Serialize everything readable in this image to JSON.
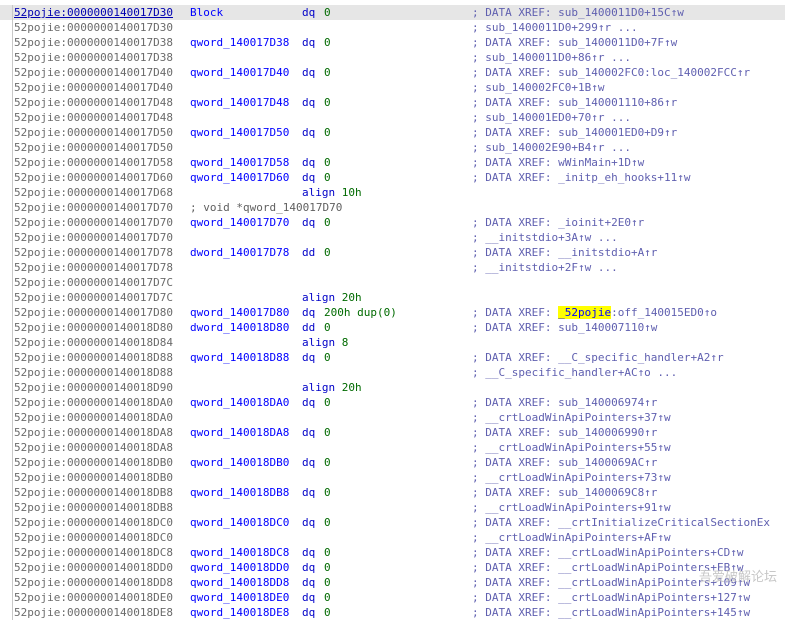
{
  "listing": {
    "rows": [
      {
        "addr": "52pojie:0000000140017D30",
        "name": "Block",
        "mnem": "dq",
        "oper": "0",
        "cmt": "; DATA XREF: sub_1400011D0+15C↑w",
        "sel": true
      },
      {
        "addr": "52pojie:0000000140017D30",
        "cmt": "; sub_1400011D0+299↑r ..."
      },
      {
        "addr": "52pojie:0000000140017D38",
        "name": "qword_140017D38",
        "mnem": "dq",
        "oper": "0",
        "cmt": "; DATA XREF: sub_1400011D0+7F↑w"
      },
      {
        "addr": "52pojie:0000000140017D38",
        "cmt": "; sub_1400011D0+86↑r ..."
      },
      {
        "addr": "52pojie:0000000140017D40",
        "name": "qword_140017D40",
        "mnem": "dq",
        "oper": "0",
        "cmt": "; DATA XREF: sub_140002FC0:loc_140002FCC↑r"
      },
      {
        "addr": "52pojie:0000000140017D40",
        "cmt": "; sub_140002FC0+1B↑w"
      },
      {
        "addr": "52pojie:0000000140017D48",
        "name": "qword_140017D48",
        "mnem": "dq",
        "oper": "0",
        "cmt": "; DATA XREF: sub_140001110+86↑r"
      },
      {
        "addr": "52pojie:0000000140017D48",
        "cmt": "; sub_140001ED0+70↑r ..."
      },
      {
        "addr": "52pojie:0000000140017D50",
        "name": "qword_140017D50",
        "mnem": "dq",
        "oper": "0",
        "cmt": "; DATA XREF: sub_140001ED0+D9↑r"
      },
      {
        "addr": "52pojie:0000000140017D50",
        "cmt": "; sub_140002E90+B4↑r ..."
      },
      {
        "addr": "52pojie:0000000140017D58",
        "name": "qword_140017D58",
        "mnem": "dq",
        "oper": "0",
        "cmt": "; DATA XREF: wWinMain+1D↑w"
      },
      {
        "addr": "52pojie:0000000140017D60",
        "name": "qword_140017D60",
        "mnem": "dq",
        "oper": "0",
        "cmt": "; DATA XREF: _initp_eh_hooks+11↑w"
      },
      {
        "addr": "52pojie:0000000140017D68",
        "align": "align",
        "alignArg": "10h"
      },
      {
        "addr": "52pojie:0000000140017D70",
        "plain": "; void *qword_140017D70"
      },
      {
        "addr": "52pojie:0000000140017D70",
        "name": "qword_140017D70",
        "mnem": "dq",
        "oper": "0",
        "cmt": "; DATA XREF: _ioinit+2E0↑r"
      },
      {
        "addr": "52pojie:0000000140017D70",
        "cmt": "; __initstdio+3A↑w ..."
      },
      {
        "addr": "52pojie:0000000140017D78",
        "name": "dword_140017D78",
        "mnem": "dd",
        "oper": "0",
        "cmt": "; DATA XREF: __initstdio+A↑r"
      },
      {
        "addr": "52pojie:0000000140017D78",
        "cmt": "; __initstdio+2F↑w ..."
      },
      {
        "addr": "52pojie:0000000140017D7C"
      },
      {
        "addr": "52pojie:0000000140017D7C",
        "align": "align",
        "alignArg": "20h"
      },
      {
        "addr": "52pojie:0000000140017D80",
        "name": "qword_140017D80",
        "mnem": "dq",
        "oper": "200h dup(0)",
        "cmtPre": "; DATA XREF: ",
        "cmtHl": "_52pojie",
        "cmtPost": ":off_140015ED0↑o"
      },
      {
        "addr": "52pojie:0000000140018D80",
        "name": "dword_140018D80",
        "mnem": "dd",
        "oper": "0",
        "cmt": "; DATA XREF: sub_140007110↑w"
      },
      {
        "addr": "52pojie:0000000140018D84",
        "align": "align",
        "alignArg": "8"
      },
      {
        "addr": "52pojie:0000000140018D88",
        "name": "qword_140018D88",
        "mnem": "dq",
        "oper": "0",
        "cmt": "; DATA XREF: __C_specific_handler+A2↑r"
      },
      {
        "addr": "52pojie:0000000140018D88",
        "cmt": "; __C_specific_handler+AC↑o ..."
      },
      {
        "addr": "52pojie:0000000140018D90",
        "align": "align",
        "alignArg": "20h"
      },
      {
        "addr": "52pojie:0000000140018DA0",
        "name": "qword_140018DA0",
        "mnem": "dq",
        "oper": "0",
        "cmt": "; DATA XREF: sub_140006974↑r"
      },
      {
        "addr": "52pojie:0000000140018DA0",
        "cmt": "; __crtLoadWinApiPointers+37↑w"
      },
      {
        "addr": "52pojie:0000000140018DA8",
        "name": "qword_140018DA8",
        "mnem": "dq",
        "oper": "0",
        "cmt": "; DATA XREF: sub_140006990↑r"
      },
      {
        "addr": "52pojie:0000000140018DA8",
        "cmt": "; __crtLoadWinApiPointers+55↑w"
      },
      {
        "addr": "52pojie:0000000140018DB0",
        "name": "qword_140018DB0",
        "mnem": "dq",
        "oper": "0",
        "cmt": "; DATA XREF: sub_1400069AC↑r"
      },
      {
        "addr": "52pojie:0000000140018DB0",
        "cmt": "; __crtLoadWinApiPointers+73↑w"
      },
      {
        "addr": "52pojie:0000000140018DB8",
        "name": "qword_140018DB8",
        "mnem": "dq",
        "oper": "0",
        "cmt": "; DATA XREF: sub_1400069C8↑r"
      },
      {
        "addr": "52pojie:0000000140018DB8",
        "cmt": "; __crtLoadWinApiPointers+91↑w"
      },
      {
        "addr": "52pojie:0000000140018DC0",
        "name": "qword_140018DC0",
        "mnem": "dq",
        "oper": "0",
        "cmt": "; DATA XREF: __crtInitializeCriticalSectionEx"
      },
      {
        "addr": "52pojie:0000000140018DC0",
        "cmt": "; __crtLoadWinApiPointers+AF↑w"
      },
      {
        "addr": "52pojie:0000000140018DC8",
        "name": "qword_140018DC8",
        "mnem": "dq",
        "oper": "0",
        "cmt": "; DATA XREF: __crtLoadWinApiPointers+CD↑w"
      },
      {
        "addr": "52pojie:0000000140018DD0",
        "name": "qword_140018DD0",
        "mnem": "dq",
        "oper": "0",
        "cmt": "; DATA XREF: __crtLoadWinApiPointers+EB↑w"
      },
      {
        "addr": "52pojie:0000000140018DD8",
        "name": "qword_140018DD8",
        "mnem": "dq",
        "oper": "0",
        "cmt": "; DATA XREF: __crtLoadWinApiPointers+109↑w"
      },
      {
        "addr": "52pojie:0000000140018DE0",
        "name": "qword_140018DE0",
        "mnem": "dq",
        "oper": "0",
        "cmt": "; DATA XREF: __crtLoadWinApiPointers+127↑w"
      },
      {
        "addr": "52pojie:0000000140018DE8",
        "name": "qword_140018DE8",
        "mnem": "dq",
        "oper": "0",
        "cmt": "; DATA XREF: __crtLoadWinApiPointers+145↑w"
      }
    ]
  },
  "watermark": "吾爱破解论坛"
}
